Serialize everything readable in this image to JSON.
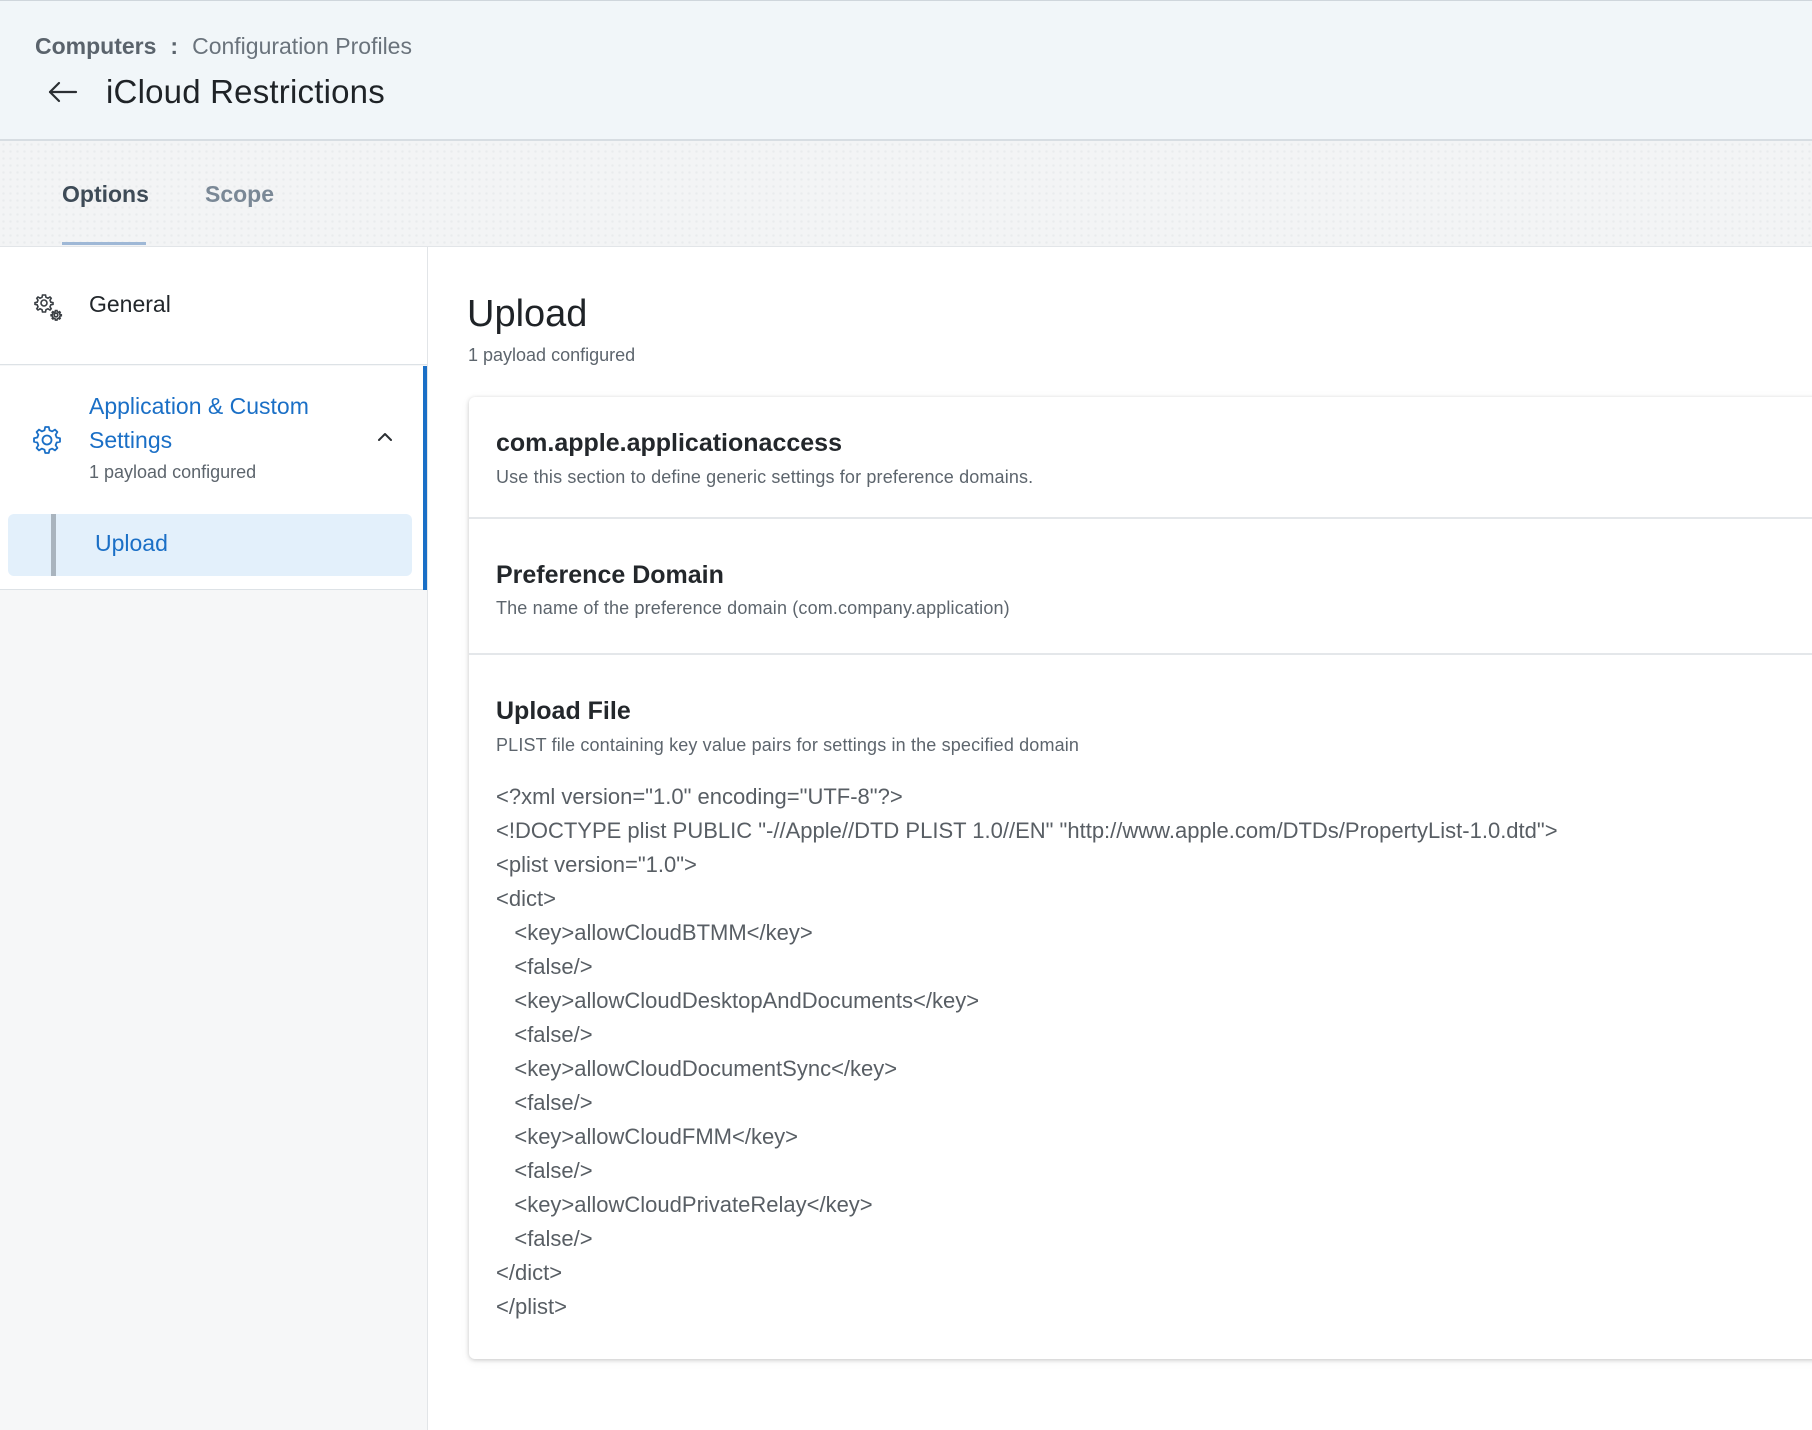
{
  "header": {
    "breadcrumb_root": "Computers",
    "breadcrumb_separator": ":",
    "breadcrumb_current": "Configuration Profiles",
    "title": "iCloud Restrictions",
    "back_icon": "arrow-left-icon"
  },
  "tabs": [
    {
      "label": "Options",
      "active": true
    },
    {
      "label": "Scope",
      "active": false
    }
  ],
  "sidebar": {
    "general": {
      "label": "General",
      "icon": "gears-icon"
    },
    "app_custom": {
      "label": "Application & Custom Settings",
      "sub": "1 payload configured",
      "icon": "gear-icon",
      "expanded": true,
      "items": [
        {
          "label": "Upload",
          "selected": true
        }
      ]
    }
  },
  "main": {
    "title": "Upload",
    "subtitle": "1 payload configured",
    "sections": [
      {
        "title": "com.apple.applicationaccess",
        "desc": "Use this section to define generic settings for preference domains."
      },
      {
        "title": "Preference Domain",
        "desc": "The name of the preference domain (com.company.application)"
      },
      {
        "title": "Upload File",
        "desc": "PLIST file containing key value pairs for settings in the specified domain"
      }
    ],
    "file_content": "<?xml version=\"1.0\" encoding=\"UTF-8\"?>\n<!DOCTYPE plist PUBLIC \"-//Apple//DTD PLIST 1.0//EN\" \"http://www.apple.com/DTDs/PropertyList-1.0.dtd\">\n<plist version=\"1.0\">\n<dict>\n\t<key>allowCloudBTMM</key>\n\t<false/>\n\t<key>allowCloudDesktopAndDocuments</key>\n\t<false/>\n\t<key>allowCloudDocumentSync</key>\n\t<false/>\n\t<key>allowCloudFMM</key>\n\t<false/>\n\t<key>allowCloudPrivateRelay</key>\n\t<false/>\n</dict>\n</plist>"
  },
  "colors": {
    "accent": "#1a6fc6",
    "header_bg": "#f1f6f9",
    "selected_bg": "#e3f0fb"
  }
}
